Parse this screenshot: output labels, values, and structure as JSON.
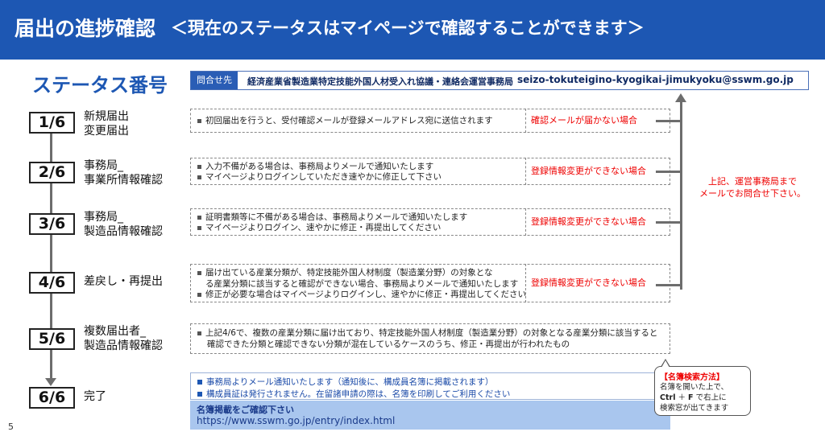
{
  "header": {
    "title": "届出の進捗確認",
    "subtitle": "＜現在のステータスはマイページで確認することができます＞"
  },
  "status_heading": "ステータス番号",
  "contact": {
    "label": "問合せ先",
    "org": "経済産業省製造業特定技能外国人材受入れ協議・連絡会運営事務局",
    "email": "seizo-tokuteigino-kyogikai-jimukyoku@sswm.go.jp",
    "note_line1": "上記、運営事務局まで",
    "note_line2": "メールでお問合せ下さい。"
  },
  "steps": [
    {
      "number": "1/6",
      "label_line1": "新規届出",
      "label_line2": "変更届出",
      "desc": [
        "初回届出を行うと、受付確認メールが登録メールアドレス宛に送信されます"
      ],
      "issue": "確認メールが届かない場合"
    },
    {
      "number": "2/6",
      "label_line1": "事務局_",
      "label_line2": "事業所情報確認",
      "desc": [
        "入力不備がある場合は、事務局よりメールで通知いたします",
        "マイページよりログインしていただき速やかに修正して下さい"
      ],
      "issue": "登録情報変更ができない場合"
    },
    {
      "number": "3/6",
      "label_line1": "事務局_",
      "label_line2": "製造品情報確認",
      "desc": [
        "証明書類等に不備がある場合は、事務局よりメールで通知いたします",
        "マイページよりログイン、速やかに修正・再提出してください"
      ],
      "issue": "登録情報変更ができない場合"
    },
    {
      "number": "4/6",
      "label_line1": "差戻し・再提出",
      "label_line2": "",
      "desc": [
        "届け出ている産業分類が、特定技能外国人材制度（製造業分野）の対象とな",
        "る産業分類に該当すると確認ができない場合、事務局よりメールで通知いたします",
        "修正が必要な場合はマイページよりログインし、速やかに修正・再提出してください"
      ],
      "issue": "登録情報変更ができない場合"
    },
    {
      "number": "5/6",
      "label_line1": "複数届出者_",
      "label_line2": "製造品情報確認",
      "desc": [
        "上記4/6で、複数の産業分類に届け出ており、特定技能外国人材制度（製造業分野）の対象となる産業分類に該当すると確認できた分類と確認できない分類が混在しているケースのうち、修正・再提出が行われたもの"
      ],
      "issue": ""
    },
    {
      "number": "6/6",
      "label_line1": "完了",
      "label_line2": "",
      "desc": [
        "事務局よりメール通知いたします（通知後に、構成員名簿に掲載されます）",
        "構成員証は発行されません。在留諸申請の際は、名簿を印刷してご利用ください"
      ],
      "issue": ""
    }
  ],
  "registry": {
    "title": "名簿掲載をご確認下さい",
    "url": "https://www.sswm.go.jp/entry/index.html"
  },
  "callout": {
    "title": "【名簿検索方法】",
    "line1": "名簿を開いた上で、",
    "key1": "Ctrl",
    "plus": "＋",
    "key2": "F",
    "line2_rest": "で右上に",
    "line3": "検索窓が出てきます"
  },
  "page_number": "5",
  "colors": {
    "header_bg": "#1d57b3",
    "issue_text": "#e00000",
    "registry_bg": "#a9c6ee"
  }
}
